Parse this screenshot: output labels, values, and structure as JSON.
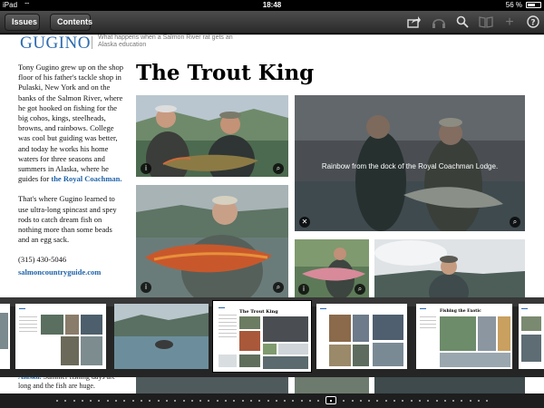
{
  "status": {
    "device": "iPad",
    "time": "18:48",
    "battery": "56 %"
  },
  "toolbar": {
    "issues_label": "Issues",
    "contents_label": "Contents",
    "icons": [
      "share-icon",
      "headphones-icon",
      "search-icon",
      "book-icon",
      "add-icon",
      "help-icon"
    ]
  },
  "page": {
    "masthead": "GUGINO",
    "tagline": "What happens when a Salmon River rat gets an Alaska education",
    "headline": "The Trout King",
    "body": {
      "p1_text": "Tony Gugino grew up on the shop floor of his father's tackle shop in Pulaski, New York and on the banks of the Salmon River, where he got hooked on fishing for the big cohos, kings, steelheads, browns, and rainbows. College was cool but guiding was better, and today he works his home waters for three seasons and summers in Alaska, where he guides for",
      "p1_link": "the Royal Coachman.",
      "p2_text": "That's where Gugino learned to use ultra-long spincast and spey rods to catch dream fish on nothing more than some beads and an egg sack.",
      "phone": "(315) 430-5046",
      "website": "salmoncountryguide.com"
    },
    "photo_caption": "Rainbow from the dock of the Royal Coachman Lodge.",
    "below_caption_bold": "Alaska.",
    "below_caption_text": "Summer fishing days are long and the fish are huge."
  },
  "thumbnails": [
    {
      "title": ""
    },
    {
      "title": ""
    },
    {
      "title": "The Trout King"
    },
    {
      "title": ""
    },
    {
      "title": "Fishing the Exotic"
    },
    {
      "title": ""
    }
  ],
  "colors": {
    "brand": "#2b6bb0",
    "toolbar": "#3a3a3a"
  }
}
